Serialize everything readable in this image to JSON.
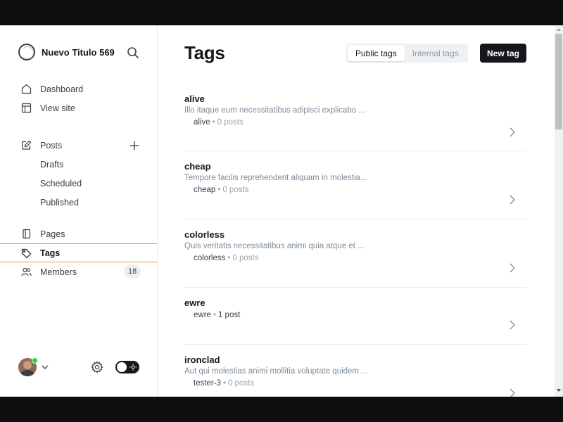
{
  "brand": {
    "title": "Nuevo Titulo 569"
  },
  "sidebar": {
    "items": [
      {
        "label": "Dashboard"
      },
      {
        "label": "View site"
      },
      {
        "label": "Posts"
      },
      {
        "label": "Drafts"
      },
      {
        "label": "Scheduled"
      },
      {
        "label": "Published"
      },
      {
        "label": "Pages"
      },
      {
        "label": "Tags"
      },
      {
        "label": "Members",
        "badge": "18"
      }
    ],
    "active": "Tags"
  },
  "main": {
    "title": "Tags",
    "tabs": [
      {
        "label": "Public tags",
        "selected": true
      },
      {
        "label": "Internal tags",
        "selected": false
      }
    ],
    "new_tag_label": "New tag"
  },
  "tags": [
    {
      "name": "alive",
      "description": "Illo itaque eum necessitatibus adipisci explicabo ...",
      "slug": "alive",
      "count": "0 posts"
    },
    {
      "name": "cheap",
      "description": "Tempore facilis reprehenderit aliquam in molestia...",
      "slug": "cheap",
      "count": "0 posts"
    },
    {
      "name": "colorless",
      "description": "Quis veritatis necessitatibus animi quia atque et ...",
      "slug": "colorless",
      "count": "0 posts"
    },
    {
      "name": "ewre",
      "description": "",
      "slug": "ewre",
      "count": "1 post"
    },
    {
      "name": "ironclad",
      "description": "Aut qui molestias animi mollitia voluptate quidem ...",
      "slug": "tester-3",
      "count": "0 posts"
    }
  ],
  "colors": {
    "accent_active_border": "#e8a313",
    "primary_button": "#15171a",
    "online_status": "#30cf43"
  }
}
